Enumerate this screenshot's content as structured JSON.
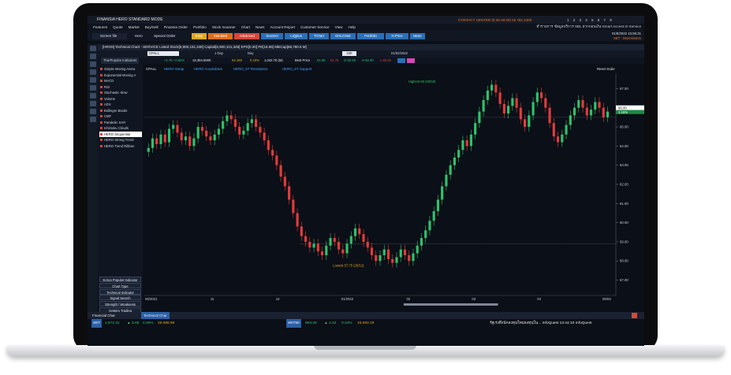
{
  "app": {
    "title": "FINANSIA  HERO  STANDARD MODE",
    "contact": "CONTACT CENTER (8:30-18:00) 02 782 2400",
    "window_nums": "1 2 3 4 5 6 7 8"
  },
  "menu": [
    "Features",
    "Quote",
    "Market",
    "Buy/Sell",
    "Finansia Order",
    "Portfolio",
    "Stock Scanner",
    "Chart",
    "News",
    "Account Report",
    "Customer Service",
    "View",
    "Help"
  ],
  "menu_right": "ทำรายการ  ข้อมูลบริการ  SBL  ฝากถอนเงิน  Smart Access  E-Service",
  "toolbar": {
    "search_label": "Screen file",
    "hero_label": "Hero",
    "special_label": "Special Order",
    "tabs": [
      {
        "label": "Easy",
        "color": "#e0a81c"
      },
      {
        "label": "Standard",
        "color": "#e06e1c"
      },
      {
        "label": "Advanced",
        "color": "#d8453b"
      },
      {
        "label": "Scanner",
        "color": "#2a6fb8"
      },
      {
        "label": "LiQplus",
        "color": "#2a6fb8"
      },
      {
        "label": "TChart",
        "color": "#2a6fb8"
      },
      {
        "label": "OHLCStat",
        "color": "#2a6fb8"
      },
      {
        "label": "Portfolio",
        "color": "#2a6fb8"
      },
      {
        "label": "H.Price",
        "color": "#2a6fb8"
      },
      {
        "label": "News",
        "color": "#2a6fb8"
      }
    ],
    "date": "01/8/2022  15:56:31",
    "set_info": "SET : Intermission"
  },
  "chart_window": {
    "title": "[HRO8] Technical Chart - SERVICE Listed Stock[6,900,101,348] Capital[6,900,101,348] EPS[0.30] PE[18.95] MktCap[56,780.5 M]",
    "symbol": "CPALL",
    "timeframe": "1 Day",
    "interval": "Day",
    "lookback": "240",
    "date_end": "01/02/2022",
    "quote": {
      "last": "61.75",
      "change": "+1.75 +2.92%",
      "volume": "16,394.500K",
      "value": "53.188",
      "pct": "0.19%",
      "avg": "1,042.76 (M)",
      "best": "Best Price",
      "bid": "61.50",
      "ask": "61.75",
      "open": "O 60.25",
      "high": "H 62.00",
      "low": "L 60.25"
    }
  },
  "indicators": {
    "header": "TharPopular Indicators",
    "items": [
      "Simple Moving Avera",
      "Exponential Moving A",
      "MACD",
      "RSI",
      "Stochastic Slow",
      "Volume",
      "ADX",
      "Bollinger Bands",
      "CMF",
      "Parabolic SAR",
      "Ichimoku Clouds",
      "HERO Sequential",
      "HERO Strong Trend",
      "HERO Trend Ribbon"
    ],
    "selected": "HERO Sequential",
    "buttons": [
      "Korea Popular Indicator",
      "Chart Type",
      "Technical Indicator",
      "Signal Search",
      "Strength / Weakness",
      "System Trading",
      "My Indicators"
    ]
  },
  "legend": [
    "CPALL",
    "HERO Setup",
    "HERO Countdown",
    "HERO_ST Resistance",
    "HERO_ST Support"
  ],
  "reset_scale": "Reset Scale",
  "statusbar": {
    "items": [
      "Financial Char",
      "Technical Char"
    ]
  },
  "ticker": {
    "set_label": "SET",
    "set_value": "1,572.31",
    "set_change": "▲ 5.66",
    "set_pct": "0.25%",
    "set_vol": "26,088.96",
    "set50_label": "SET50",
    "set50_value": "953.29",
    "set50_change": "▲ 4.22",
    "set50_pct": "0.44%",
    "set50_vol": "15,093.19",
    "news": "รัฐเร่งดึงนักลงทุนใหม่ลงทุนใน...  InfoQuest  13:44:10   InfoQuest"
  },
  "chart_data": {
    "type": "candlestick",
    "symbol": "CPALL",
    "x_ticks": [
      "09/2021",
      "11",
      "12",
      "01/2022",
      "02",
      "03",
      "04",
      "05/04"
    ],
    "y_ticks": [
      57.0,
      58.0,
      59.0,
      60.0,
      61.0,
      62.0,
      63.0,
      64.0,
      65.0,
      66.0,
      67.0
    ],
    "ylim": [
      56.2,
      67.8
    ],
    "last_price": 66.0,
    "high_price": 67.25,
    "last_pct": "1.15%",
    "resistance": 65.5,
    "support": 58.9,
    "annotations": [
      {
        "text": "Highest 65 (03/03)",
        "x": 0.56,
        "y": 67.3
      },
      {
        "text": "Lowest 57.75 (29/12)",
        "x": 0.4,
        "y": 57.7
      }
    ],
    "closes": [
      63.9,
      64.4,
      64.1,
      64.6,
      64.2,
      64.9,
      65.1,
      64.7,
      64.3,
      64.5,
      64.0,
      64.4,
      65.0,
      64.8,
      64.5,
      64.3,
      64.6,
      64.9,
      65.3,
      65.6,
      65.4,
      65.0,
      64.6,
      64.8,
      65.2,
      65.4,
      65.0,
      64.7,
      64.3,
      63.8,
      63.5,
      63.0,
      62.4,
      61.9,
      61.2,
      60.5,
      59.8,
      59.3,
      59.0,
      58.7,
      58.9,
      58.5,
      58.3,
      58.8,
      59.2,
      59.0,
      58.6,
      58.4,
      58.9,
      59.3,
      59.7,
      59.4,
      59.0,
      58.7,
      58.3,
      58.0,
      58.3,
      58.6,
      58.1,
      57.9,
      58.2,
      58.6,
      58.3,
      58.0,
      58.4,
      58.8,
      59.2,
      59.6,
      60.1,
      60.6,
      61.2,
      61.9,
      62.5,
      63.0,
      63.4,
      63.8,
      64.3,
      64.0,
      64.6,
      65.2,
      65.8,
      66.4,
      66.9,
      67.2,
      66.8,
      66.2,
      65.7,
      66.1,
      66.5,
      66.0,
      65.4,
      65.0,
      65.6,
      66.3,
      66.8,
      66.5,
      66.0,
      65.2,
      64.5,
      64.2,
      64.6,
      65.1,
      65.6,
      66.0,
      66.4,
      66.0,
      65.6,
      65.9,
      66.3,
      66.0,
      65.5,
      65.8
    ]
  }
}
